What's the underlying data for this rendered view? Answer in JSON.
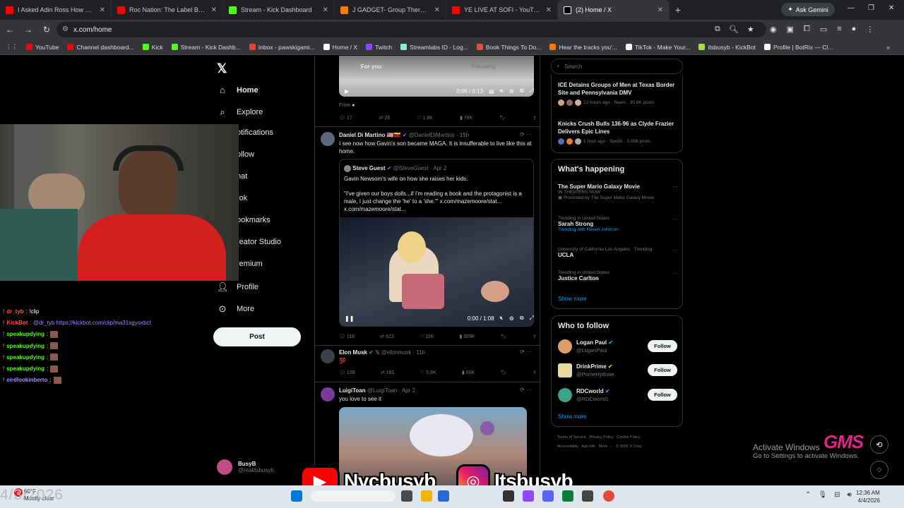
{
  "tabs": [
    {
      "label": "I Asked Adin Ross How He Ma",
      "color": "#ff0000"
    },
    {
      "label": "Roc Nation: The Label Bullying",
      "color": "#ff0000"
    },
    {
      "label": "Stream - Kick Dashboard",
      "color": "#53fc18"
    },
    {
      "label": "J GADGET- Group Therapy",
      "color": "#f57c00"
    },
    {
      "label": "YE LIVE AT SOFI - YouTube",
      "color": "#ff0000"
    },
    {
      "label": "(2) Home / X",
      "color": "#ffffff"
    }
  ],
  "gemini_label": "Ask Gemini",
  "url": "x.com/home",
  "bookmarks": [
    {
      "label": "YouTube",
      "color": "#ff0000"
    },
    {
      "label": "Channel dashboard...",
      "color": "#ff0000"
    },
    {
      "label": "Kick",
      "color": "#53fc18"
    },
    {
      "label": "Stream - Kick Dashb...",
      "color": "#53fc18"
    },
    {
      "label": "Inbox - pawskigami...",
      "color": "#ea4335"
    },
    {
      "label": "Home / X",
      "color": "#ffffff"
    },
    {
      "label": "Twitch",
      "color": "#9146ff"
    },
    {
      "label": "Streamlabs ID - Log...",
      "color": "#80f5d2"
    },
    {
      "label": "Book Things To Do...",
      "color": "#e94b3c"
    },
    {
      "label": "Hear the tracks you'...",
      "color": "#f57c00"
    },
    {
      "label": "TikTok - Make Your...",
      "color": "#ffffff"
    },
    {
      "label": "itsbusyb - KickBot",
      "color": "#a3e635"
    },
    {
      "label": "Profile | BotRix — Cl...",
      "color": "#ffffff"
    }
  ],
  "nav": {
    "home": "Home",
    "explore": "Explore",
    "notifications": "otifications",
    "follow": "ollow",
    "chat": "hat",
    "grok": "rok",
    "bookmarks": "ookmarks",
    "creator": "reator Studio",
    "premium": "remium",
    "profile": "Profile",
    "more": "More",
    "post": "Post"
  },
  "account": {
    "name": "BusyB",
    "handle": "@realitsbusyb"
  },
  "feed": {
    "tab_for_you": "For you",
    "tab_following": "Following",
    "video1_time": "0:06 / 0:13",
    "from_label": "From",
    "stats1": {
      "replies": "17",
      "reposts": "26",
      "likes": "1.8K",
      "views": "79K"
    },
    "tweet2": {
      "name": "Daniel Di Martino",
      "handle": "@DanielDiMartino · 15h",
      "text": "I see now how Gavin's son became MAGA. It is insufferable to live like this at home.",
      "quote_name": "Steve Guest",
      "quote_handle": "@SteveGuest · Apr 2",
      "quote_text1": "Gavin Newsom's wife on how she raises her kids:",
      "quote_text2": "\"I've given our boys dolls...if I'm reading a book and the protagonist is a male, I just change the 'he' to a 'she.'\" x.com/mazemoore/stat... x.com/mazemoore/stat...",
      "video_time": "0:00 / 1:08",
      "stats": {
        "replies": "118",
        "reposts": "622",
        "likes": "11K",
        "views": "309K"
      }
    },
    "tweet3": {
      "name": "Elon Musk",
      "handle": "@elonmusk · 11h",
      "stats": {
        "replies": "138",
        "reposts": "181",
        "likes": "5.6K",
        "views": "60K"
      }
    },
    "tweet4": {
      "name": "LuigiToan",
      "handle": "@LuigiToan · Apr 2",
      "text": "you love to see it"
    }
  },
  "right": {
    "search_placeholder": "Search",
    "news": [
      {
        "title": "ICE Detains Groups of Men at Texas Border Site and Pennsylvania DMV",
        "meta": "12 hours ago · News · 30.6K posts"
      },
      {
        "title": "Knicks Crush Bulls 136-96 as Clyde Frazier Delivers Epic Lines",
        "meta": "1 hour ago · Sports · 3,008 posts"
      }
    ],
    "happening_title": "What's happening",
    "trends": [
      {
        "ctx": "",
        "name": "The Super Mario Galaxy Movie",
        "sub": "IN THEATERS NOW",
        "promo": "Promoted by The Super Mario Galaxy Movie"
      },
      {
        "ctx": "Trending in United States",
        "name": "Sarah Strong",
        "sub": "Trending with Raven Johnson"
      },
      {
        "ctx": "University of California Los Angeles · Trending",
        "name": "UCLA",
        "sub": ""
      },
      {
        "ctx": "Trending in United States",
        "name": "Justice Carlton",
        "sub": ""
      }
    ],
    "show_more": "Show more",
    "wtf_title": "Who to follow",
    "follow": [
      {
        "name": "Logan Paul",
        "handle": "@LoganPaul",
        "btn": "Follow",
        "color": "#d8a06a"
      },
      {
        "name": "DrinkPrime",
        "handle": "@PrimeHydrate",
        "btn": "Follow",
        "color": "#e8d9a0"
      },
      {
        "name": "RDCworld",
        "handle": "@RDCworld1",
        "btn": "Follow",
        "color": "#3aa38a"
      }
    ],
    "footer": [
      "Terms of Service",
      "Privacy Policy",
      "Cookie Policy",
      "Accessibility",
      "Ads info",
      "More ···",
      "© 2026 X Corp."
    ]
  },
  "chat": [
    {
      "user": "dr_tyb",
      "msg": ": !clip",
      "color": "#ff4d4d"
    },
    {
      "user": "KickBot",
      "msg": ": @dr_tyb https://kickbot.com/clip/ma31sgyoxbct",
      "color": "#ff4d4d"
    },
    {
      "user": "speakupdying",
      "msg": ":",
      "color": "#53fc18"
    },
    {
      "user": "speakupdying",
      "msg": ":",
      "color": "#53fc18"
    },
    {
      "user": "speakupdying",
      "msg": ":",
      "color": "#53fc18"
    },
    {
      "user": "speakupdying",
      "msg": ":",
      "color": "#53fc18"
    },
    {
      "user": "eirdlookinberto",
      "msg": ":",
      "color": "#a78bfa"
    }
  ],
  "overlay": {
    "activate1": "Activate Windows",
    "activate2": "Go to Settings to activate Windows.",
    "gms": "GMS",
    "youtube_handle": "Nycbusyb",
    "instagram_handle": "Itsbusyb",
    "date_overlay": "4/3/2026"
  },
  "taskbar": {
    "temp": "60°F",
    "weather": "Mostly clear",
    "time": "12:36 AM",
    "date": "4/4/2026",
    "badge": "2"
  }
}
